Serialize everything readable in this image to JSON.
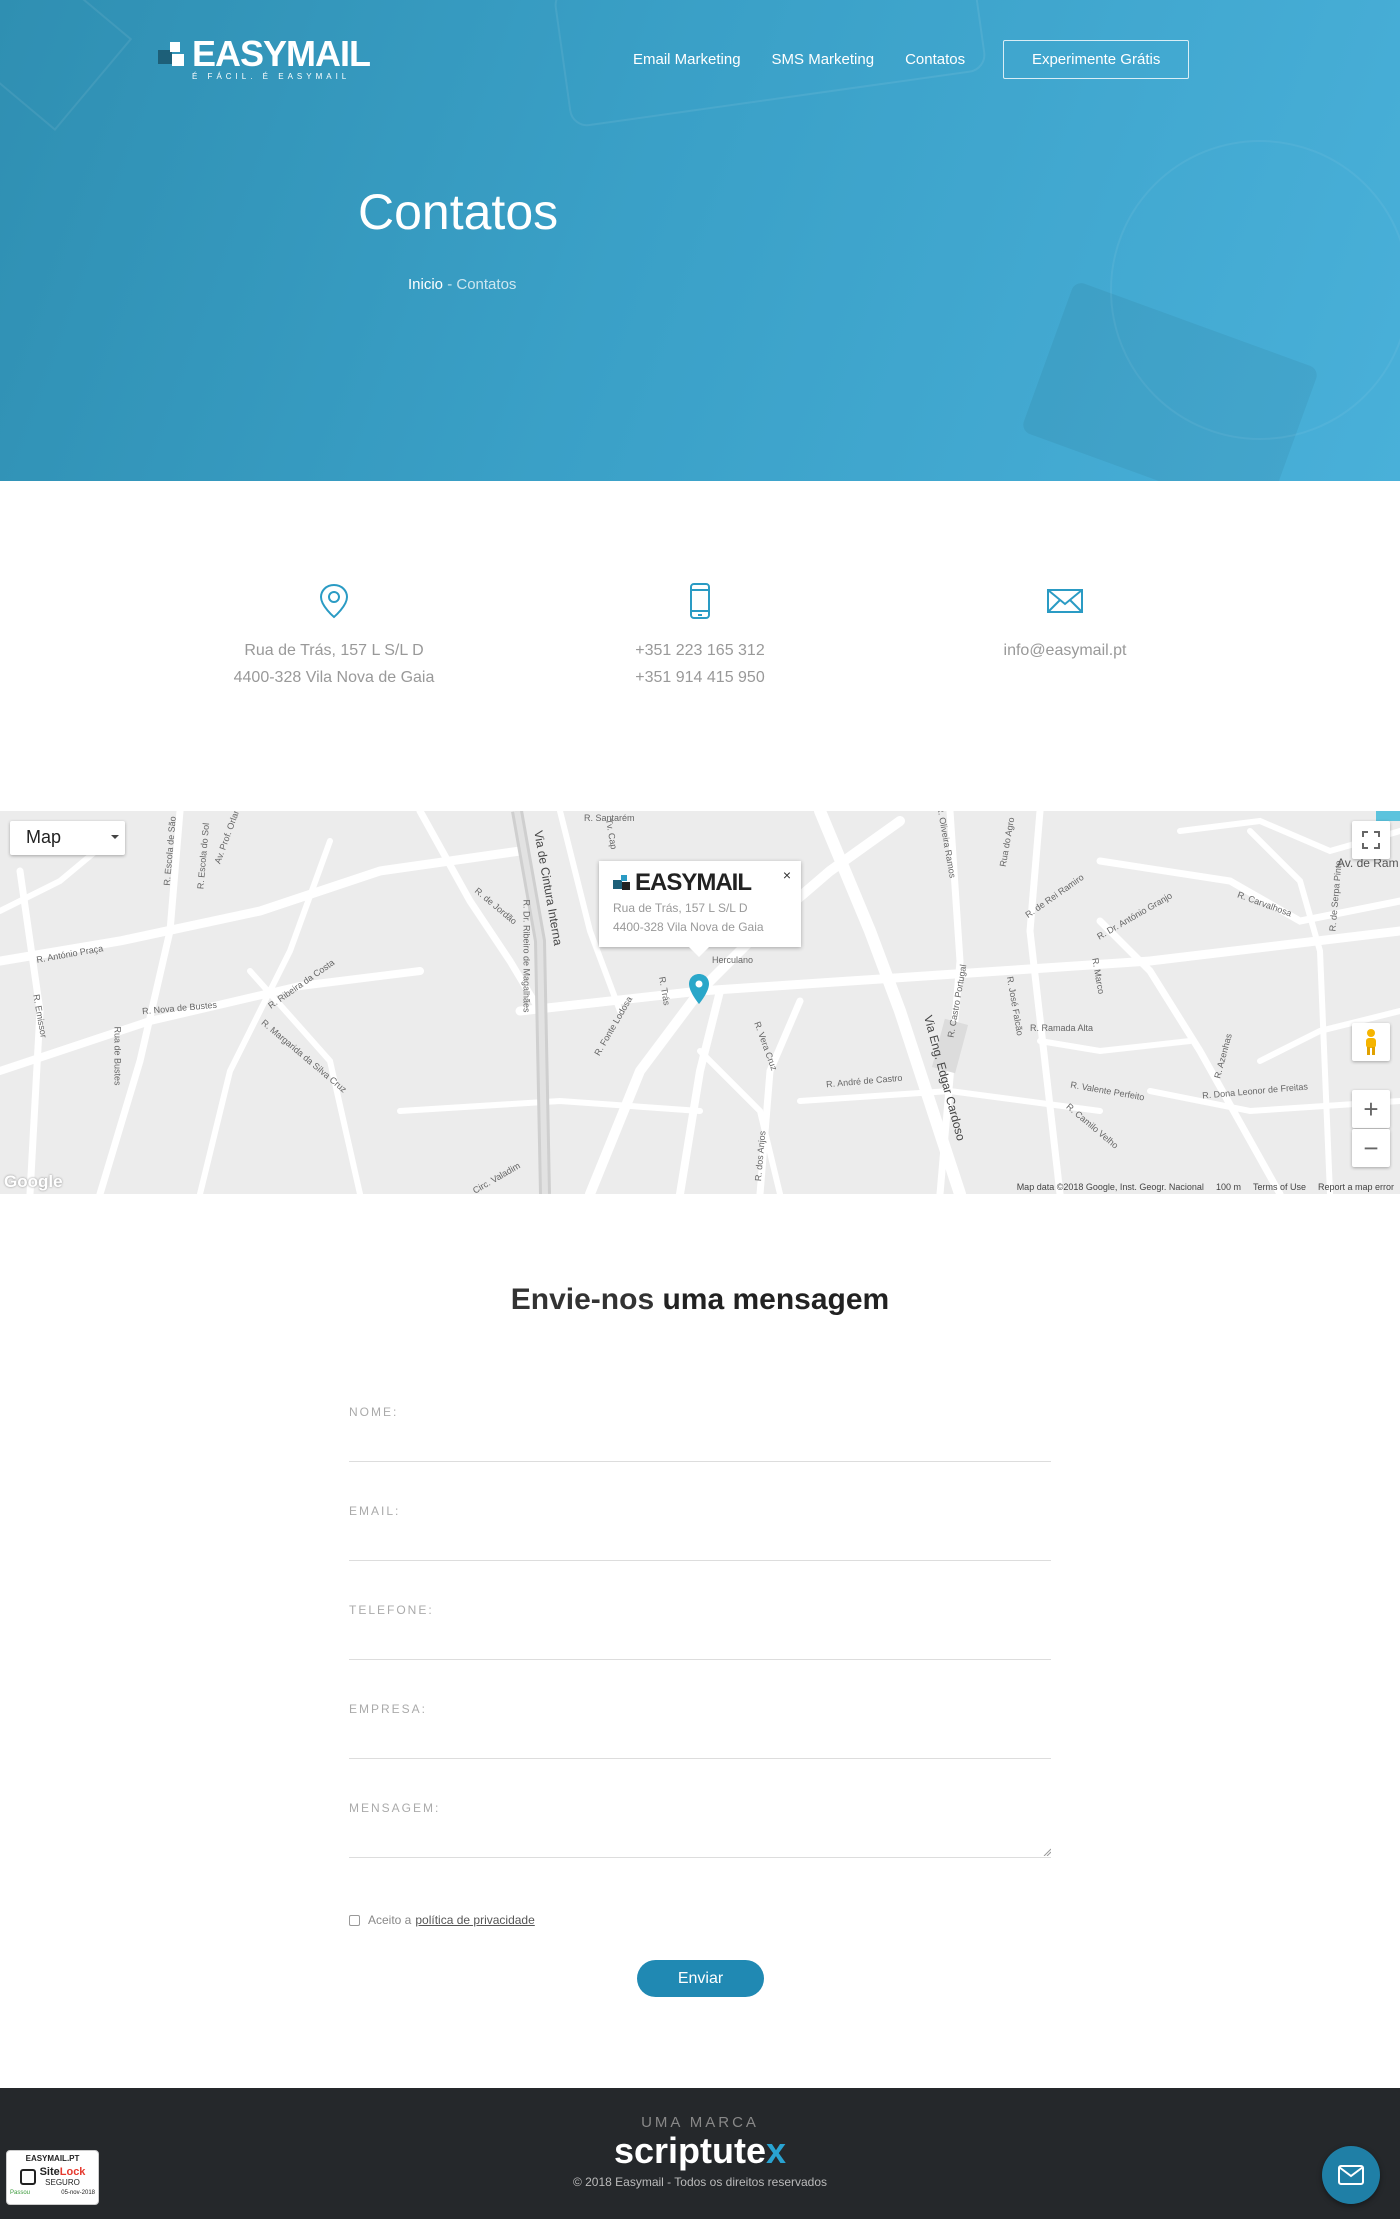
{
  "header": {
    "logo_name": "EASYMAIL",
    "logo_tag": "É FÁCIL. É EASYMAIL",
    "nav": [
      {
        "label": "Email Marketing"
      },
      {
        "label": "SMS Marketing"
      },
      {
        "label": "Contatos"
      }
    ],
    "cta_label": "Experimente Grátis"
  },
  "hero": {
    "title": "Contatos",
    "breadcrumb_home": "Inicio",
    "breadcrumb_sep": " - ",
    "breadcrumb_current": "Contatos"
  },
  "contact": {
    "address_line1": "Rua de Trás, 157 L S/L D",
    "address_line2": "4400-328 Vila Nova de Gaia",
    "phone1": "+351 223 165 312",
    "phone2": "+351 914 415 950",
    "email": "info@easymail.pt",
    "accent_color": "#2a9bc4"
  },
  "map": {
    "type_label": "Map",
    "infowindow_logo": "EASYMAIL",
    "infowindow_line1": "Rua de Trás, 157 L S/L D",
    "infowindow_line2": "4400-328 Vila Nova de Gaia",
    "close": "×",
    "google": "Google",
    "attribution": "Map data ©2018 Google, Inst. Geogr. Nacional",
    "scale": "100 m",
    "terms": "Terms of Use",
    "report": "Report a map error",
    "zoom_in": "+",
    "zoom_out": "−",
    "labels": {
      "l1": "R. Santarém",
      "l2": "Tv. Cap",
      "l3": "R. Oliveira Ramos",
      "l4": "Rua do Agro",
      "l5": "R. de Rei Ramiro",
      "l6": "Av. de Ram",
      "l7": "R. Dr. António Granjo",
      "l8": "R. Carvalhosa",
      "l9": "R. António Praça",
      "l10": "R. Nova de Bustes",
      "l11": "R. Ribeira da Costa",
      "l12": "R. Margarida da Silva Cruz",
      "l13": "R. de Jordão",
      "l14": "R. Dr. Ribeiro de Magalhães",
      "l15": "Rua de Bustes",
      "l16": "R. Fonte Lodosa",
      "l17": "R. Trás",
      "l18": "R. Vera Cruz",
      "l19": "R. André de Castro",
      "l20": "Via Eng. Edgar Cardoso",
      "l21": "R. Castro Portugal",
      "l22": "R. José Falcão",
      "l23": "R. Ramada Alta",
      "l24": "R. Valente Perfeito",
      "l25": "R. Dona Leonor de Freitas",
      "l26": "R. Camilo Velho",
      "l27": "R. de Serpa Pinto",
      "l28": "R. dos Anjos",
      "l29": "Herculano",
      "l30": "R. Marco",
      "l31": "R. Azenhas",
      "l32": "R. Emissor",
      "l33": "Circ. Valadim",
      "l34": "Via de Cintura Interna",
      "l35": "R. Escola do Sol",
      "l36": "R. Escola de São",
      "l37": "Av. Prof. Orlan"
    }
  },
  "form": {
    "title_light": "Envie-nos ",
    "title_bold": "uma mensagem",
    "fields": [
      {
        "label": "NOME:"
      },
      {
        "label": "EMAIL:"
      },
      {
        "label": "TELEFONE:"
      },
      {
        "label": "EMPRESA:"
      },
      {
        "label": "MENSAGEM:"
      }
    ],
    "privacy_text": "Aceito a",
    "privacy_link": "política de privacidade",
    "submit_label": "Enviar"
  },
  "footer": {
    "brand_pre": "UMA MARCA",
    "brand_name": "scriptute",
    "brand_x": "x",
    "copyright": "© 2018 Easymail - Todos os direitos reservados",
    "sitelock_site": "EASYMAIL.PT",
    "sitelock_name_a": "Site",
    "sitelock_name_b": "Lock",
    "sitelock_sub": "SEGURO",
    "sitelock_pass": "Passou",
    "sitelock_date": "05-nov-2018"
  }
}
